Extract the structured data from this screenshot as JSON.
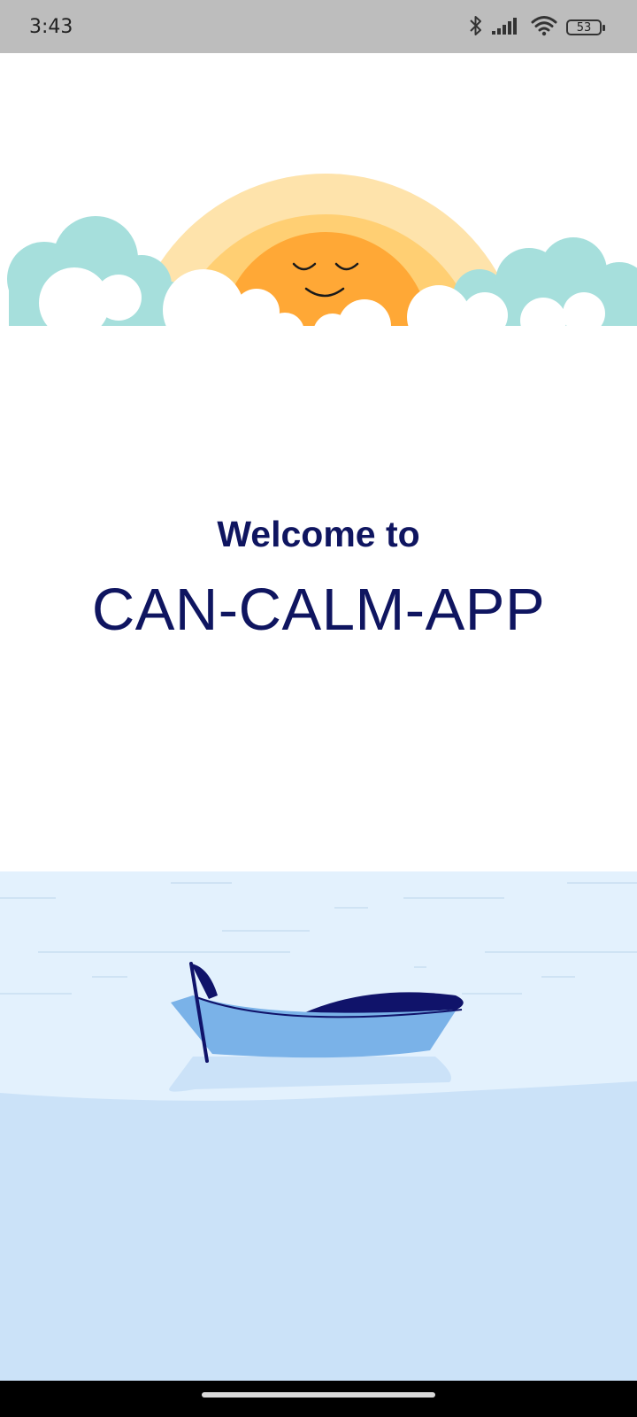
{
  "status_bar": {
    "time": "3:43",
    "battery_level": "53",
    "icons": [
      "bluetooth-icon",
      "signal-icon",
      "wifi-icon",
      "battery-icon"
    ]
  },
  "welcome": {
    "greeting": "Welcome to",
    "app_name": "CAN-CALM-APP"
  },
  "colors": {
    "title": "#0f1560",
    "sun": "#ffa836",
    "sun_ring_inner": "#ffcf73",
    "sun_ring_outer": "#fee3ab",
    "cloud": "#a6dfdc",
    "water_light": "#e3f1fd",
    "water_dark": "#cbe2f8",
    "boat": "#7ab2e8",
    "boat_dark": "#10136a"
  }
}
